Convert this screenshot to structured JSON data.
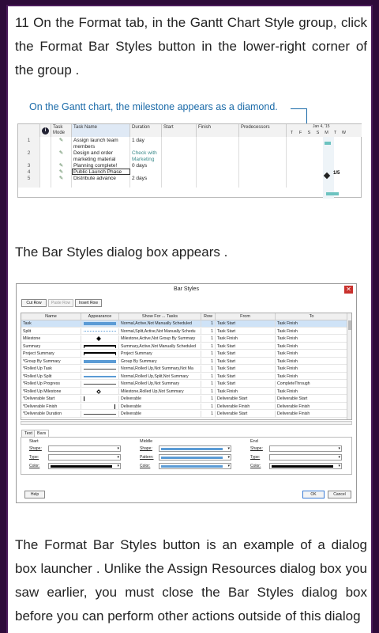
{
  "paragraphs": {
    "p1": "11 On the Format tab, in the Gantt Chart Style group, click the Format Bar Styles button in the lower-right corner of the group .",
    "p2": "The Bar Styles dialog box appears .",
    "p3": "The Format Bar Styles button is an example of a dialog box launcher . Unlike the Assign Resources dialog box you saw earlier, you must close the Bar Styles dialog box before you can perform other actions outside of this dialog"
  },
  "gantt_figure": {
    "callout": "On the Gantt chart, the milestone appears as a diamond.",
    "headers": {
      "info": "i",
      "task_mode": "Task Mode",
      "task_name": "Task Name",
      "duration": "Duration",
      "start": "Start",
      "finish": "Finish",
      "predecessors": "Predecessors"
    },
    "timescale_date": "Jan 4, '15",
    "timescale_days": [
      "T",
      "F",
      "S",
      "S",
      "M",
      "T",
      "W"
    ],
    "milestone_label": "1/5",
    "rows": [
      {
        "id": "1",
        "name": "Assign launch team members",
        "duration": "1 day",
        "note": ""
      },
      {
        "id": "2",
        "name": "Design and order marketing material",
        "duration": "",
        "note": "Check with Marketing"
      },
      {
        "id": "3",
        "name": "Planning complete!",
        "duration": "0 days",
        "note": ""
      },
      {
        "id": "4",
        "name": "Public Launch Phase",
        "duration": "",
        "note": ""
      },
      {
        "id": "5",
        "name": "Distribute advance",
        "duration": "2 days",
        "note": ""
      }
    ]
  },
  "bar_styles_dialog": {
    "title": "Bar Styles",
    "close": "✕",
    "buttons": {
      "cut_row": "Cut Row",
      "paste_row": "Paste Row",
      "insert_row": "Insert Row"
    },
    "columns": [
      "Name",
      "Appearance",
      "Show For ... Tasks",
      "Row",
      "From",
      "To"
    ],
    "rows": [
      {
        "name": "Task",
        "show_for": "Normal,Active,Not Manually Scheduled",
        "row": "1",
        "from": "Task Start",
        "to": "Task Finish"
      },
      {
        "name": "Split",
        "show_for": "Normal,Split,Active,Not Manually Schedu",
        "row": "1",
        "from": "Task Start",
        "to": "Task Finish"
      },
      {
        "name": "Milestone",
        "show_for": "Milestone,Active,Not Group By Summary",
        "row": "1",
        "from": "Task Finish",
        "to": "Task Finish"
      },
      {
        "name": "Summary",
        "show_for": "Summary,Active,Not Manually Scheduled",
        "row": "1",
        "from": "Task Start",
        "to": "Task Finish"
      },
      {
        "name": "Project Summary",
        "show_for": "Project Summary",
        "row": "1",
        "from": "Task Start",
        "to": "Task Finish"
      },
      {
        "name": "*Group By Summary",
        "show_for": "Group By Summary",
        "row": "1",
        "from": "Task Start",
        "to": "Task Finish"
      },
      {
        "name": "*Rolled Up Task",
        "show_for": "Normal,Rolled Up,Not Summary,Not Ma",
        "row": "1",
        "from": "Task Start",
        "to": "Task Finish"
      },
      {
        "name": "*Rolled Up Split",
        "show_for": "Normal,Rolled Up,Split,Not Summary",
        "row": "1",
        "from": "Task Start",
        "to": "Task Finish"
      },
      {
        "name": "*Rolled Up Progress",
        "show_for": "Normal,Rolled Up,Not Summary",
        "row": "1",
        "from": "Task Start",
        "to": "CompleteThrough"
      },
      {
        "name": "*Rolled Up Milestone",
        "show_for": "Milestone,Rolled Up,Not Summary",
        "row": "1",
        "from": "Task Finish",
        "to": "Task Finish"
      },
      {
        "name": "*Deliverable Start",
        "show_for": "Deliverable",
        "row": "1",
        "from": "Deliverable Start",
        "to": "Deliverable Start"
      },
      {
        "name": "*Deliverable Finish",
        "show_for": "Deliverable",
        "row": "1",
        "from": "Deliverable Finish",
        "to": "Deliverable Finish"
      },
      {
        "name": "*Deliverable Duration",
        "show_for": "Deliverable",
        "row": "1",
        "from": "Deliverable Start",
        "to": "Deliverable Finish"
      }
    ],
    "tabs": [
      "Text",
      "Bars"
    ],
    "groups": {
      "start": "Start",
      "middle": "Middle",
      "end": "End"
    },
    "fields": {
      "shape": "Shape:",
      "type": "Type:",
      "pattern": "Pattern:",
      "color": "Color:"
    },
    "footer": {
      "help": "Help",
      "ok": "OK",
      "cancel": "Cancel"
    },
    "colors": {
      "selection": "#cfe3f7",
      "task_bar": "#5b9bd5",
      "black": "#000000"
    }
  }
}
